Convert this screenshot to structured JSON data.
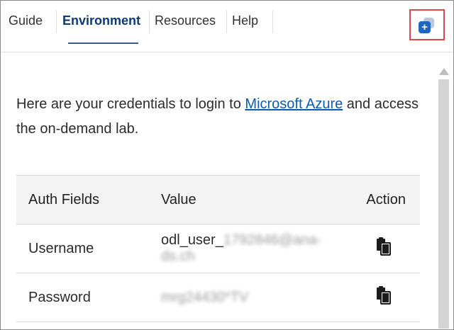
{
  "tabs": [
    {
      "label": "Guide"
    },
    {
      "label": "Environment",
      "active": true
    },
    {
      "label": "Resources"
    },
    {
      "label": "Help"
    }
  ],
  "popout_icon": "popout-window-icon",
  "intro": {
    "before_link": "Here are your credentials to login to ",
    "link_text": "Microsoft Azure",
    "after_link": " and access the on-demand lab."
  },
  "table": {
    "headers": [
      "Auth Fields",
      "Value",
      "Action"
    ],
    "rows": [
      {
        "field": "Username",
        "value_visible": "odl_user_",
        "value_obscured": "1792846@ana-ds.ch",
        "action_icon": "copy-icon"
      },
      {
        "field": "Password",
        "value_visible": "",
        "value_obscured": "mrg24430*TV",
        "action_icon": "copy-icon"
      }
    ]
  },
  "colors": {
    "active_tab": "#0e3a70",
    "link": "#0b5cad",
    "highlight_box": "#e0474c",
    "popout_icon": "#1f66c1"
  }
}
